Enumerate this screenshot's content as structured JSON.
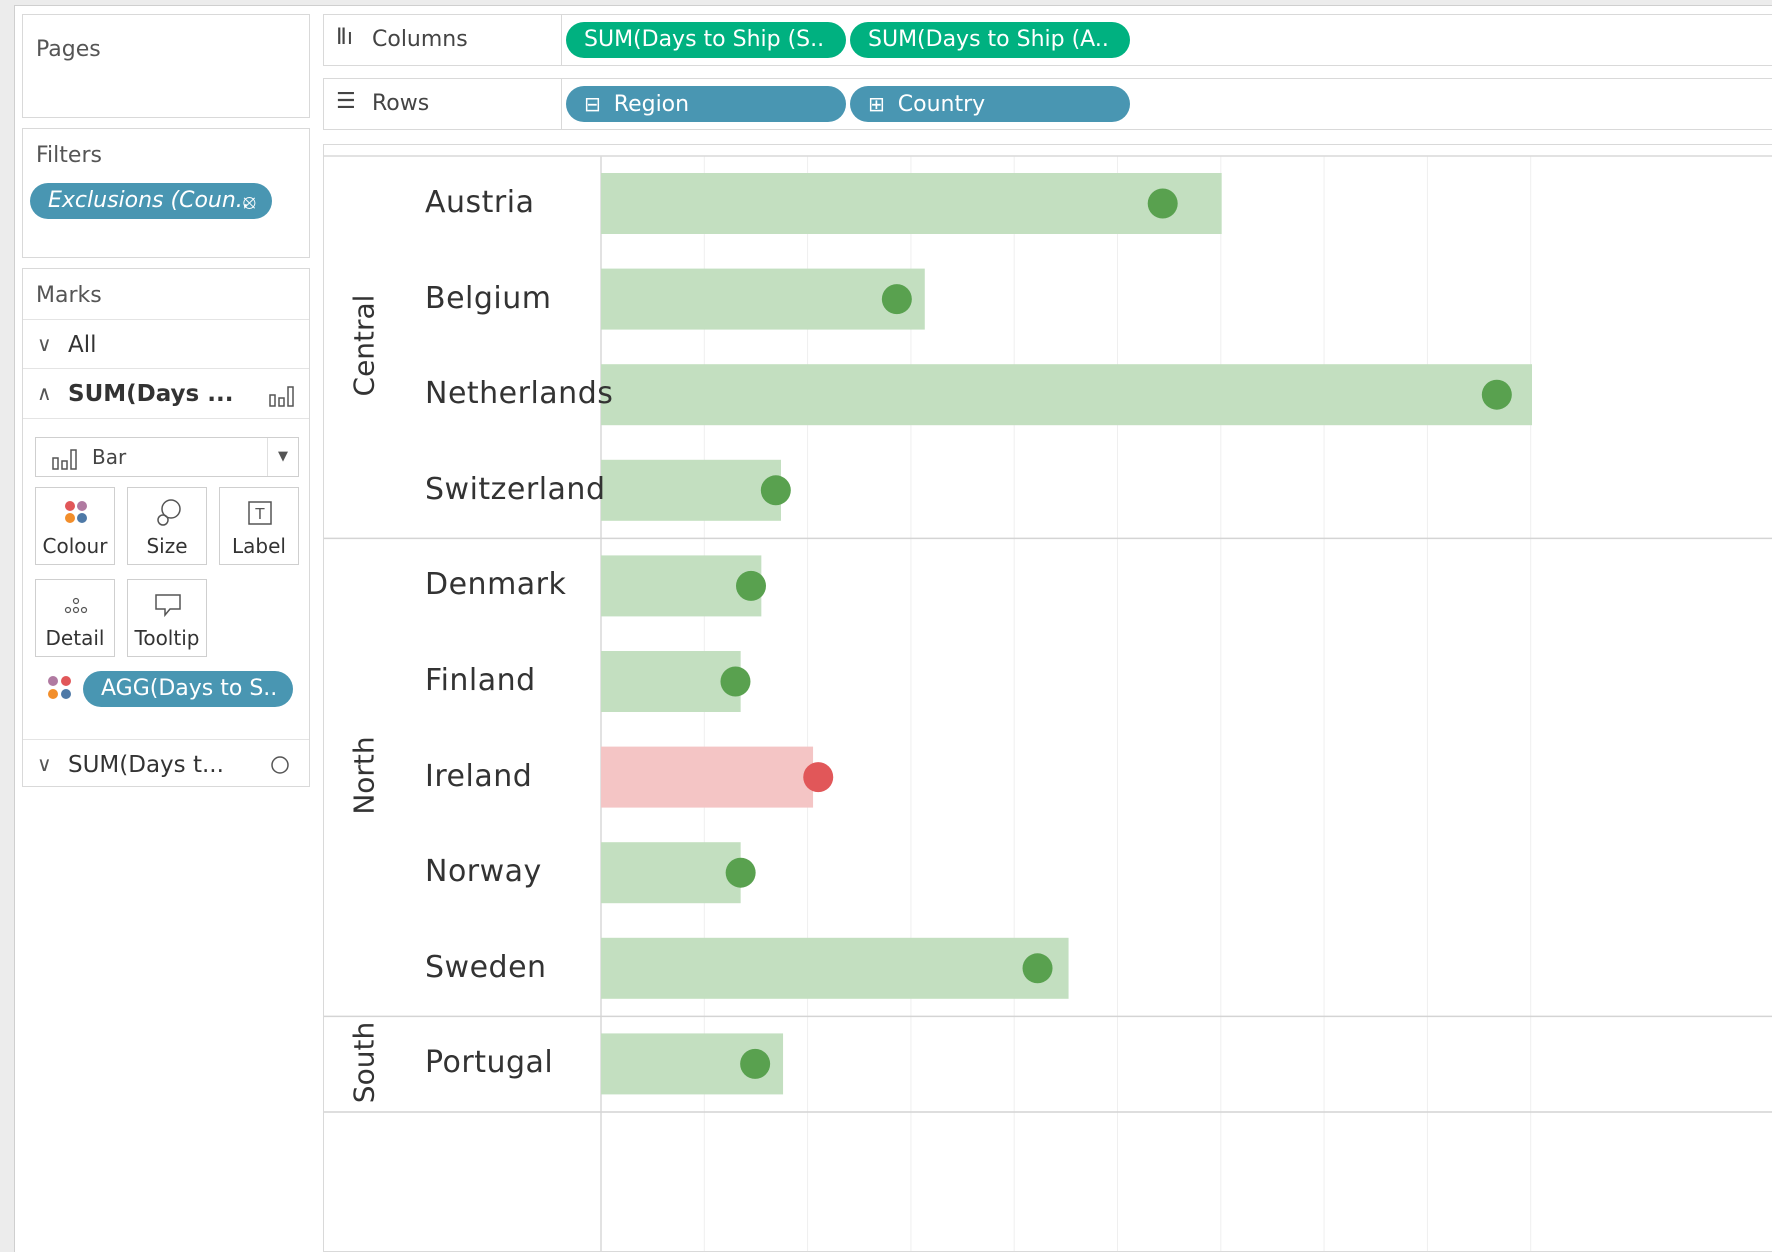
{
  "pages": {
    "title": "Pages"
  },
  "filters": {
    "title": "Filters",
    "pill": "Exclusions (Coun.."
  },
  "marks": {
    "title": "Marks",
    "all_label": "All",
    "card1_label": "SUM(Days ...",
    "mark_type": "Bar",
    "buttons": {
      "colour": "Colour",
      "size": "Size",
      "label": "Label",
      "detail": "Detail",
      "tooltip": "Tooltip"
    },
    "colour_pill": "AGG(Days to S..",
    "card2_label": "SUM(Days t..."
  },
  "shelves": {
    "columns_label": "Columns",
    "columns_pills": [
      "SUM(Days to Ship (S..",
      "SUM(Days to Ship (A.."
    ],
    "rows_label": "Rows",
    "rows_pills": [
      "Region",
      "Country"
    ]
  },
  "colors": {
    "measure_pill": "#00b180",
    "dimension_pill": "#4996b2",
    "bar_ok": "#c3dfc0",
    "dot_ok": "#59a14f",
    "bar_bad": "#f4c5c5",
    "dot_bad": "#e15759"
  },
  "chart_data": {
    "type": "bar",
    "bar_measure": "SUM(Days to Ship (S..",
    "dot_measure": "SUM(Days to Ship (A..",
    "gridlines": "vertical",
    "xlim": [
      0,
      9.0
    ],
    "regions": [
      {
        "name": "Central",
        "countries": [
          "Austria",
          "Belgium",
          "Netherlands",
          "Switzerland"
        ]
      },
      {
        "name": "North",
        "countries": [
          "Denmark",
          "Finland",
          "Ireland",
          "Norway",
          "Sweden"
        ]
      },
      {
        "name": "South",
        "countries": [
          "Portugal"
        ]
      }
    ],
    "rows": [
      {
        "country": "Austria",
        "region": "Central",
        "bar": 6.0,
        "dot": 5.43,
        "flag": "ok"
      },
      {
        "country": "Belgium",
        "region": "Central",
        "bar": 3.13,
        "dot": 2.86,
        "flag": "ok"
      },
      {
        "country": "Netherlands",
        "region": "Central",
        "bar": 9.0,
        "dot": 8.66,
        "flag": "ok"
      },
      {
        "country": "Switzerland",
        "region": "Central",
        "bar": 1.74,
        "dot": 1.69,
        "flag": "ok"
      },
      {
        "country": "Denmark",
        "region": "North",
        "bar": 1.55,
        "dot": 1.45,
        "flag": "ok"
      },
      {
        "country": "Finland",
        "region": "North",
        "bar": 1.35,
        "dot": 1.3,
        "flag": "ok"
      },
      {
        "country": "Ireland",
        "region": "North",
        "bar": 2.05,
        "dot": 2.1,
        "flag": "bad"
      },
      {
        "country": "Norway",
        "region": "North",
        "bar": 1.35,
        "dot": 1.35,
        "flag": "ok"
      },
      {
        "country": "Sweden",
        "region": "North",
        "bar": 4.52,
        "dot": 4.22,
        "flag": "ok"
      },
      {
        "country": "Portugal",
        "region": "South",
        "bar": 1.76,
        "dot": 1.49,
        "flag": "ok"
      }
    ]
  }
}
